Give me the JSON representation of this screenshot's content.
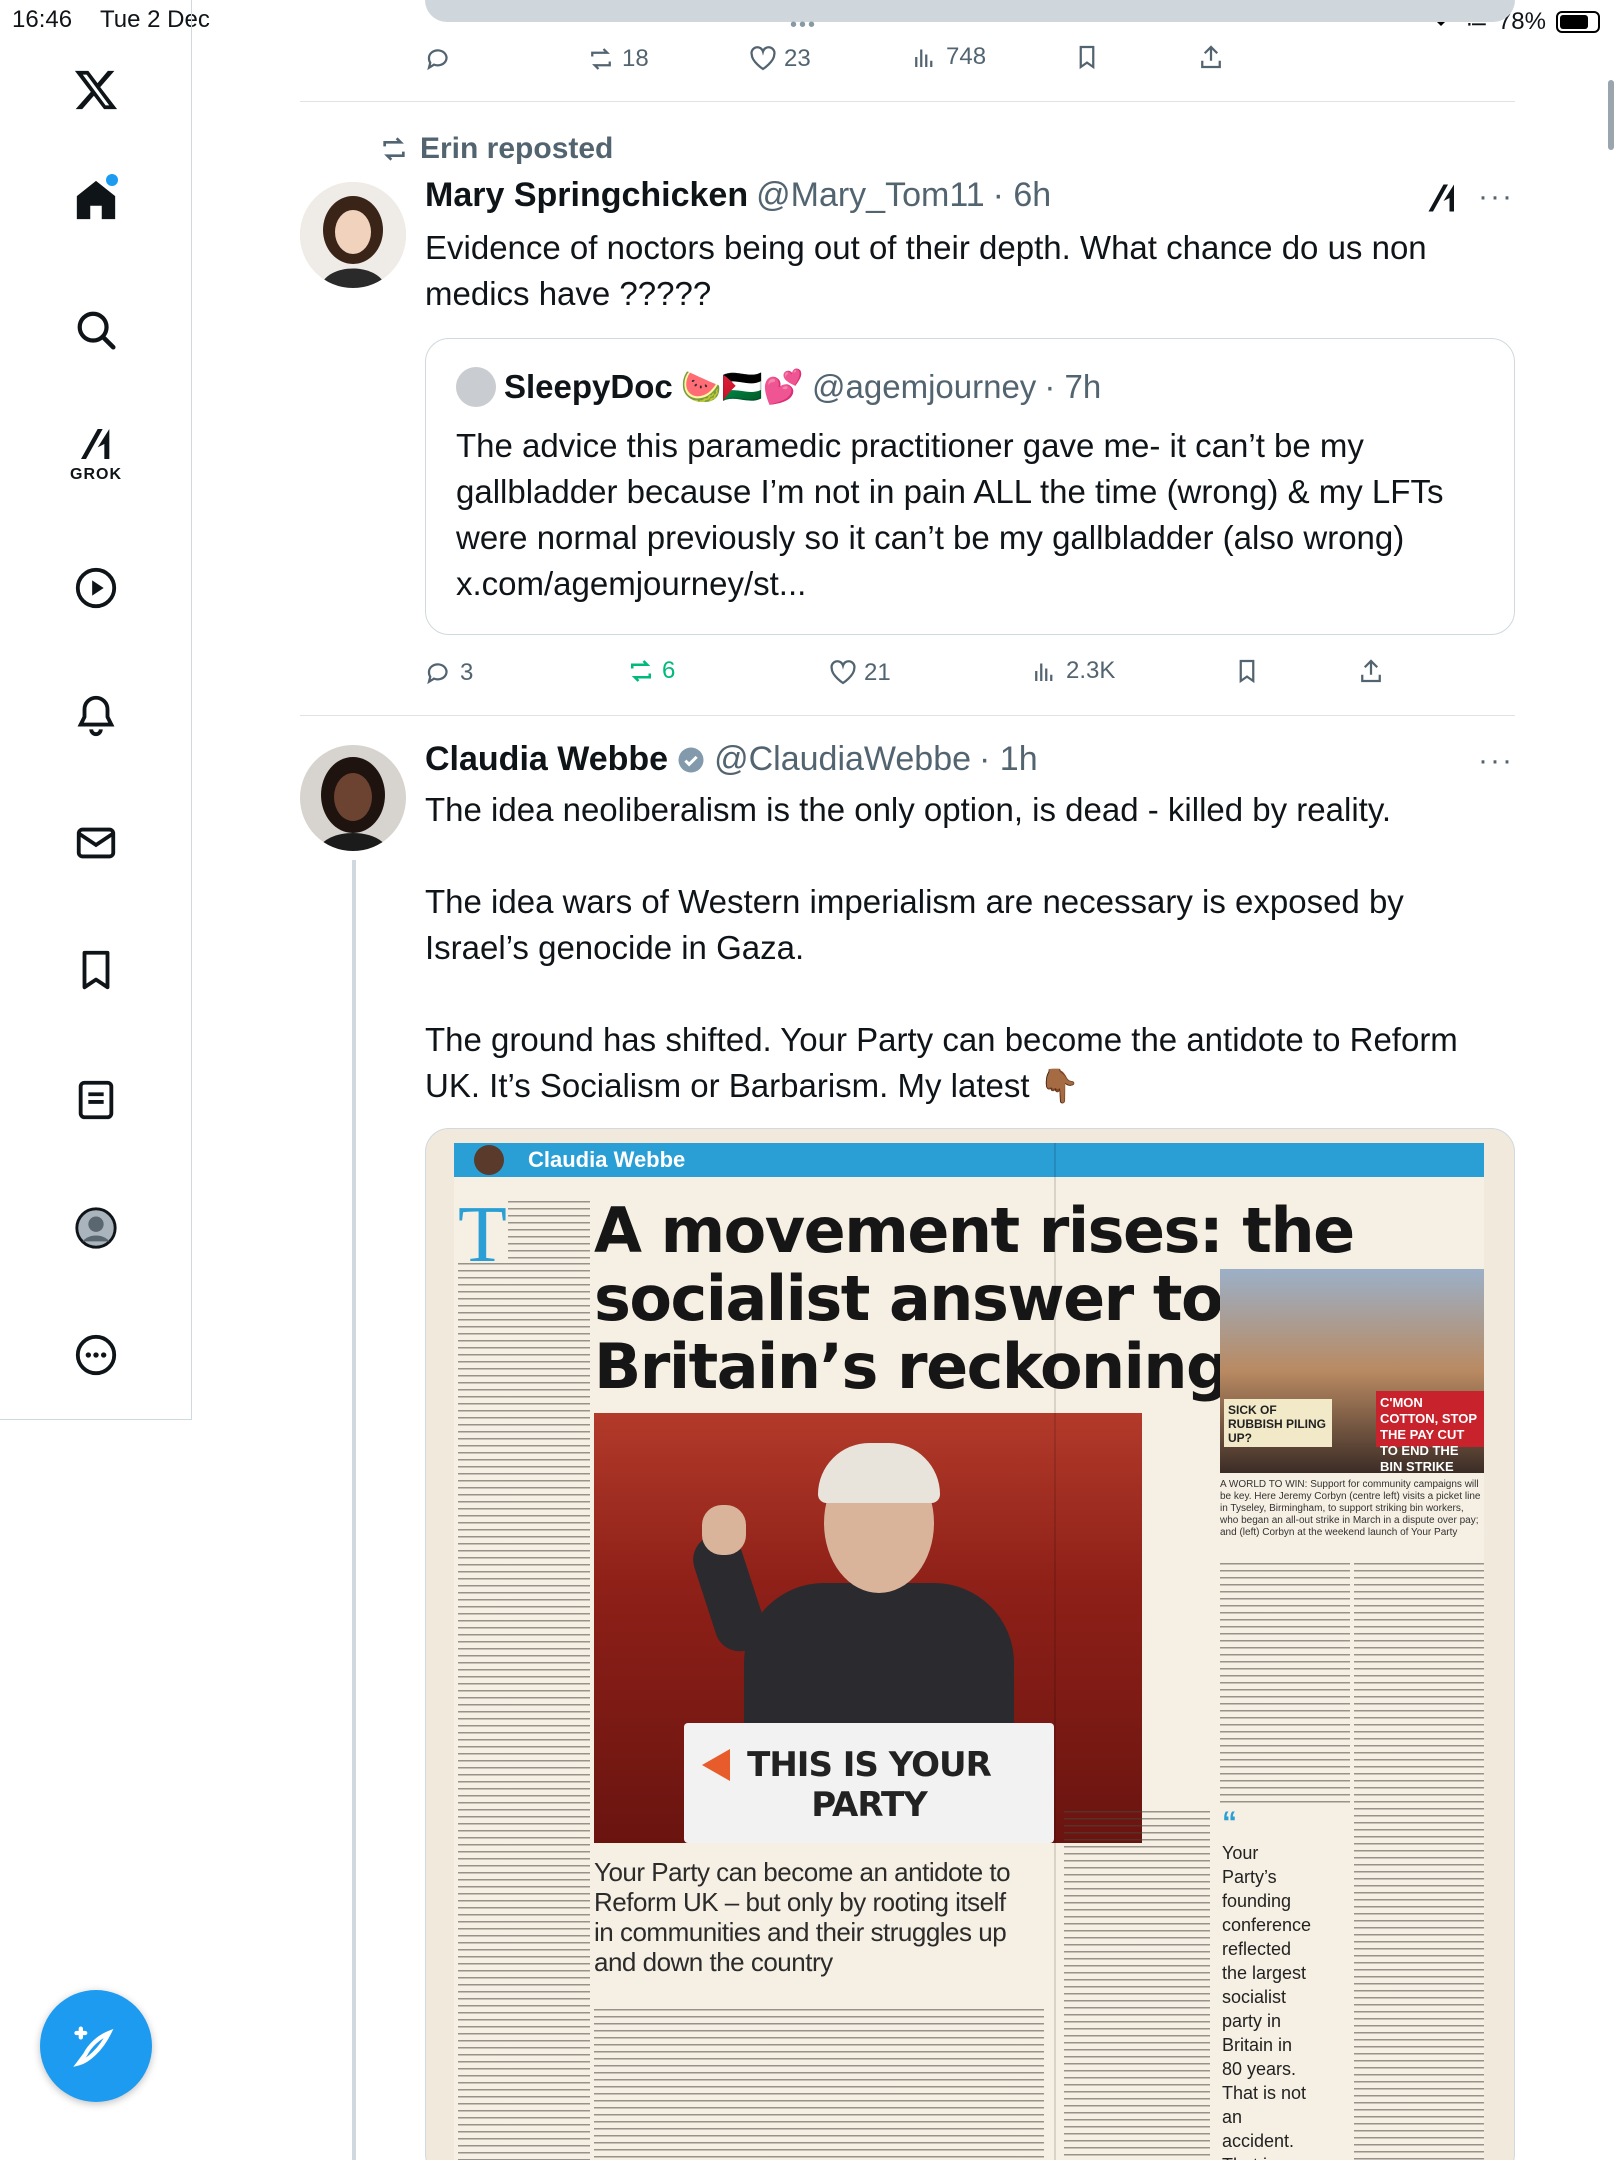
{
  "status_bar": {
    "time": "16:46",
    "date": "Tue 2 Dec",
    "battery": "78%",
    "battery_level": 0.78
  },
  "nav": {
    "items": [
      {
        "name": "x-logo"
      },
      {
        "name": "home"
      },
      {
        "name": "search"
      },
      {
        "name": "grok",
        "label": "GROK"
      },
      {
        "name": "video"
      },
      {
        "name": "notifications"
      },
      {
        "name": "messages"
      },
      {
        "name": "bookmarks"
      },
      {
        "name": "lists"
      },
      {
        "name": "profile"
      },
      {
        "name": "more"
      }
    ]
  },
  "prev_tweet_actions": {
    "replies": "",
    "reposts": "18",
    "likes": "23",
    "views": "748"
  },
  "tweet1": {
    "repost_label": "Erin reposted",
    "name": "Mary Springchicken",
    "handle": "@Mary_Tom11",
    "time": "· 6h",
    "text": "Evidence of noctors being out of their depth. What chance do us non medics have ?????",
    "quote": {
      "name": "SleepyDoc",
      "emojis": "🍉🇵🇸💕",
      "handle": "@agemjourney",
      "time": "· 7h",
      "text": "The advice this paramedic practitioner gave me- it can’t be my gallbladder because I’m not in pain ALL the time (wrong) & my LFTs were normal previously so it can’t be my gallbladder (also wrong) x.com/agemjourney/st..."
    },
    "actions": {
      "replies": "3",
      "reposts": "6",
      "likes": "21",
      "views": "2.3K"
    }
  },
  "tweet2": {
    "name": "Claudia Webbe",
    "handle": "@ClaudiaWebbe",
    "time": "· 1h",
    "para1": "The idea neoliberalism is the only option, is dead - killed by reality.",
    "para2": "The idea wars of Western imperialism are necessary is exposed by Israel’s genocide in Gaza.",
    "para3": "The ground has shifted. Your Party can become the antidote to Reform UK. It’s Socialism or Barbarism. My latest 👇🏾",
    "article": {
      "byline": "Claudia Webbe",
      "headline_l1": "A movement rises: the",
      "headline_l2": "socialist answer to",
      "headline_l3": "Britain’s reckoning",
      "podium": "THIS IS YOUR PARTY",
      "subdeck": "Your Party can become an antidote to Reform UK – but only by rooting itself in communities and their struggles up and down the country",
      "side_sign1": "SICK OF RUBBISH PILING UP?",
      "side_sign2": "C'MON COTTON, STOP THE PAY CUT TO END THE BIN STRIKE",
      "side_caption": "A WORLD TO WIN: Support for community campaigns will be key. Here Jeremy Corbyn (centre left) visits a picket line in Tyseley, Birmingham, to support striking bin workers, who began an all-out strike in March in a dispute over pay; and (left) Corbyn at the weekend launch of Your Party",
      "pull_quote": "Your Party’s founding conference reflected the largest socialist party in Britain in 80 years. That is not an accident. That is a response to a vacuum",
      "drop_cap": "T"
    }
  },
  "colors": {
    "accent": "#1d9bf0",
    "repost_green": "#00ba7c",
    "muted": "#536471",
    "paper_blue": "#2a9fd6"
  }
}
